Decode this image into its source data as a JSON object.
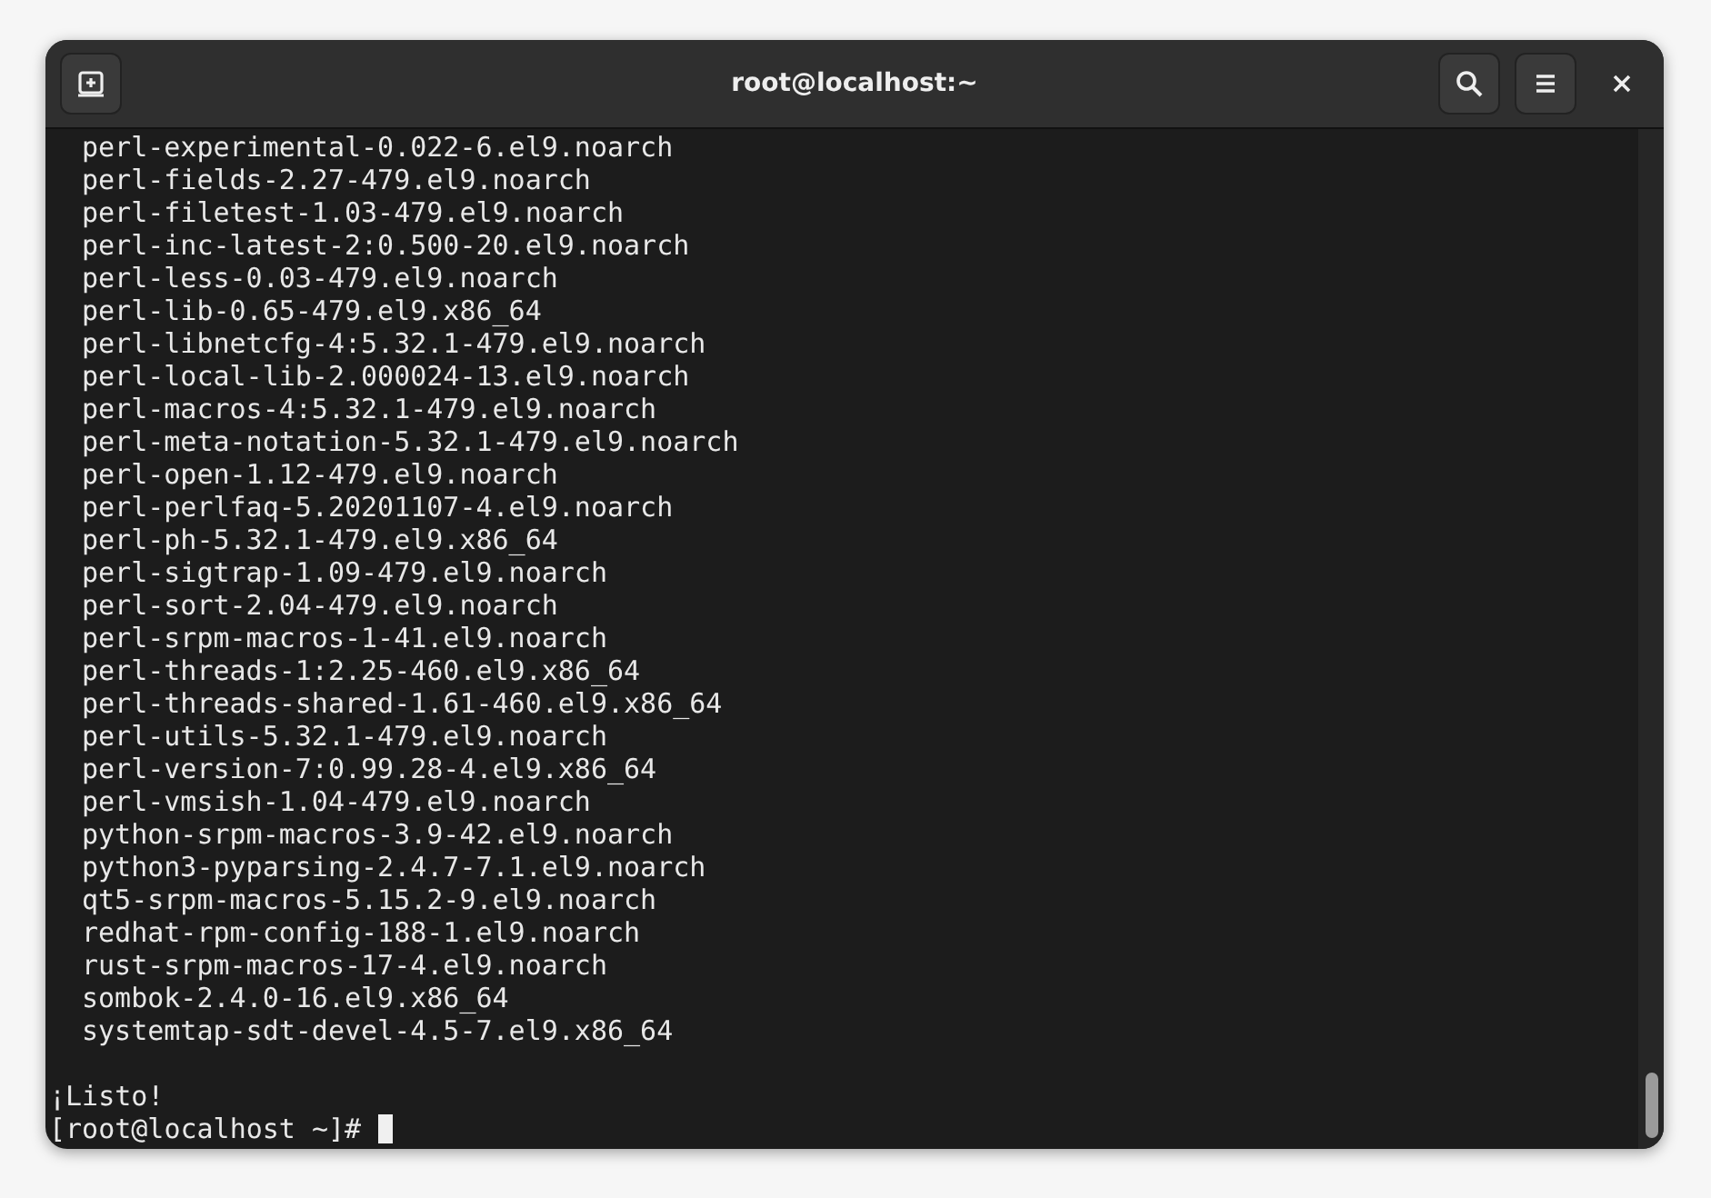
{
  "window": {
    "title": "root@localhost:~"
  },
  "terminal": {
    "packages": [
      "perl-experimental-0.022-6.el9.noarch",
      "perl-fields-2.27-479.el9.noarch",
      "perl-filetest-1.03-479.el9.noarch",
      "perl-inc-latest-2:0.500-20.el9.noarch",
      "perl-less-0.03-479.el9.noarch",
      "perl-lib-0.65-479.el9.x86_64",
      "perl-libnetcfg-4:5.32.1-479.el9.noarch",
      "perl-local-lib-2.000024-13.el9.noarch",
      "perl-macros-4:5.32.1-479.el9.noarch",
      "perl-meta-notation-5.32.1-479.el9.noarch",
      "perl-open-1.12-479.el9.noarch",
      "perl-perlfaq-5.20201107-4.el9.noarch",
      "perl-ph-5.32.1-479.el9.x86_64",
      "perl-sigtrap-1.09-479.el9.noarch",
      "perl-sort-2.04-479.el9.noarch",
      "perl-srpm-macros-1-41.el9.noarch",
      "perl-threads-1:2.25-460.el9.x86_64",
      "perl-threads-shared-1.61-460.el9.x86_64",
      "perl-utils-5.32.1-479.el9.noarch",
      "perl-version-7:0.99.28-4.el9.x86_64",
      "perl-vmsish-1.04-479.el9.noarch",
      "python-srpm-macros-3.9-42.el9.noarch",
      "python3-pyparsing-2.4.7-7.1.el9.noarch",
      "qt5-srpm-macros-5.15.2-9.el9.noarch",
      "redhat-rpm-config-188-1.el9.noarch",
      "rust-srpm-macros-17-4.el9.noarch",
      "sombok-2.4.0-16.el9.x86_64",
      "systemtap-sdt-devel-4.5-7.el9.x86_64"
    ],
    "message": "¡Listo!",
    "prompt": "[root@localhost ~]#"
  }
}
